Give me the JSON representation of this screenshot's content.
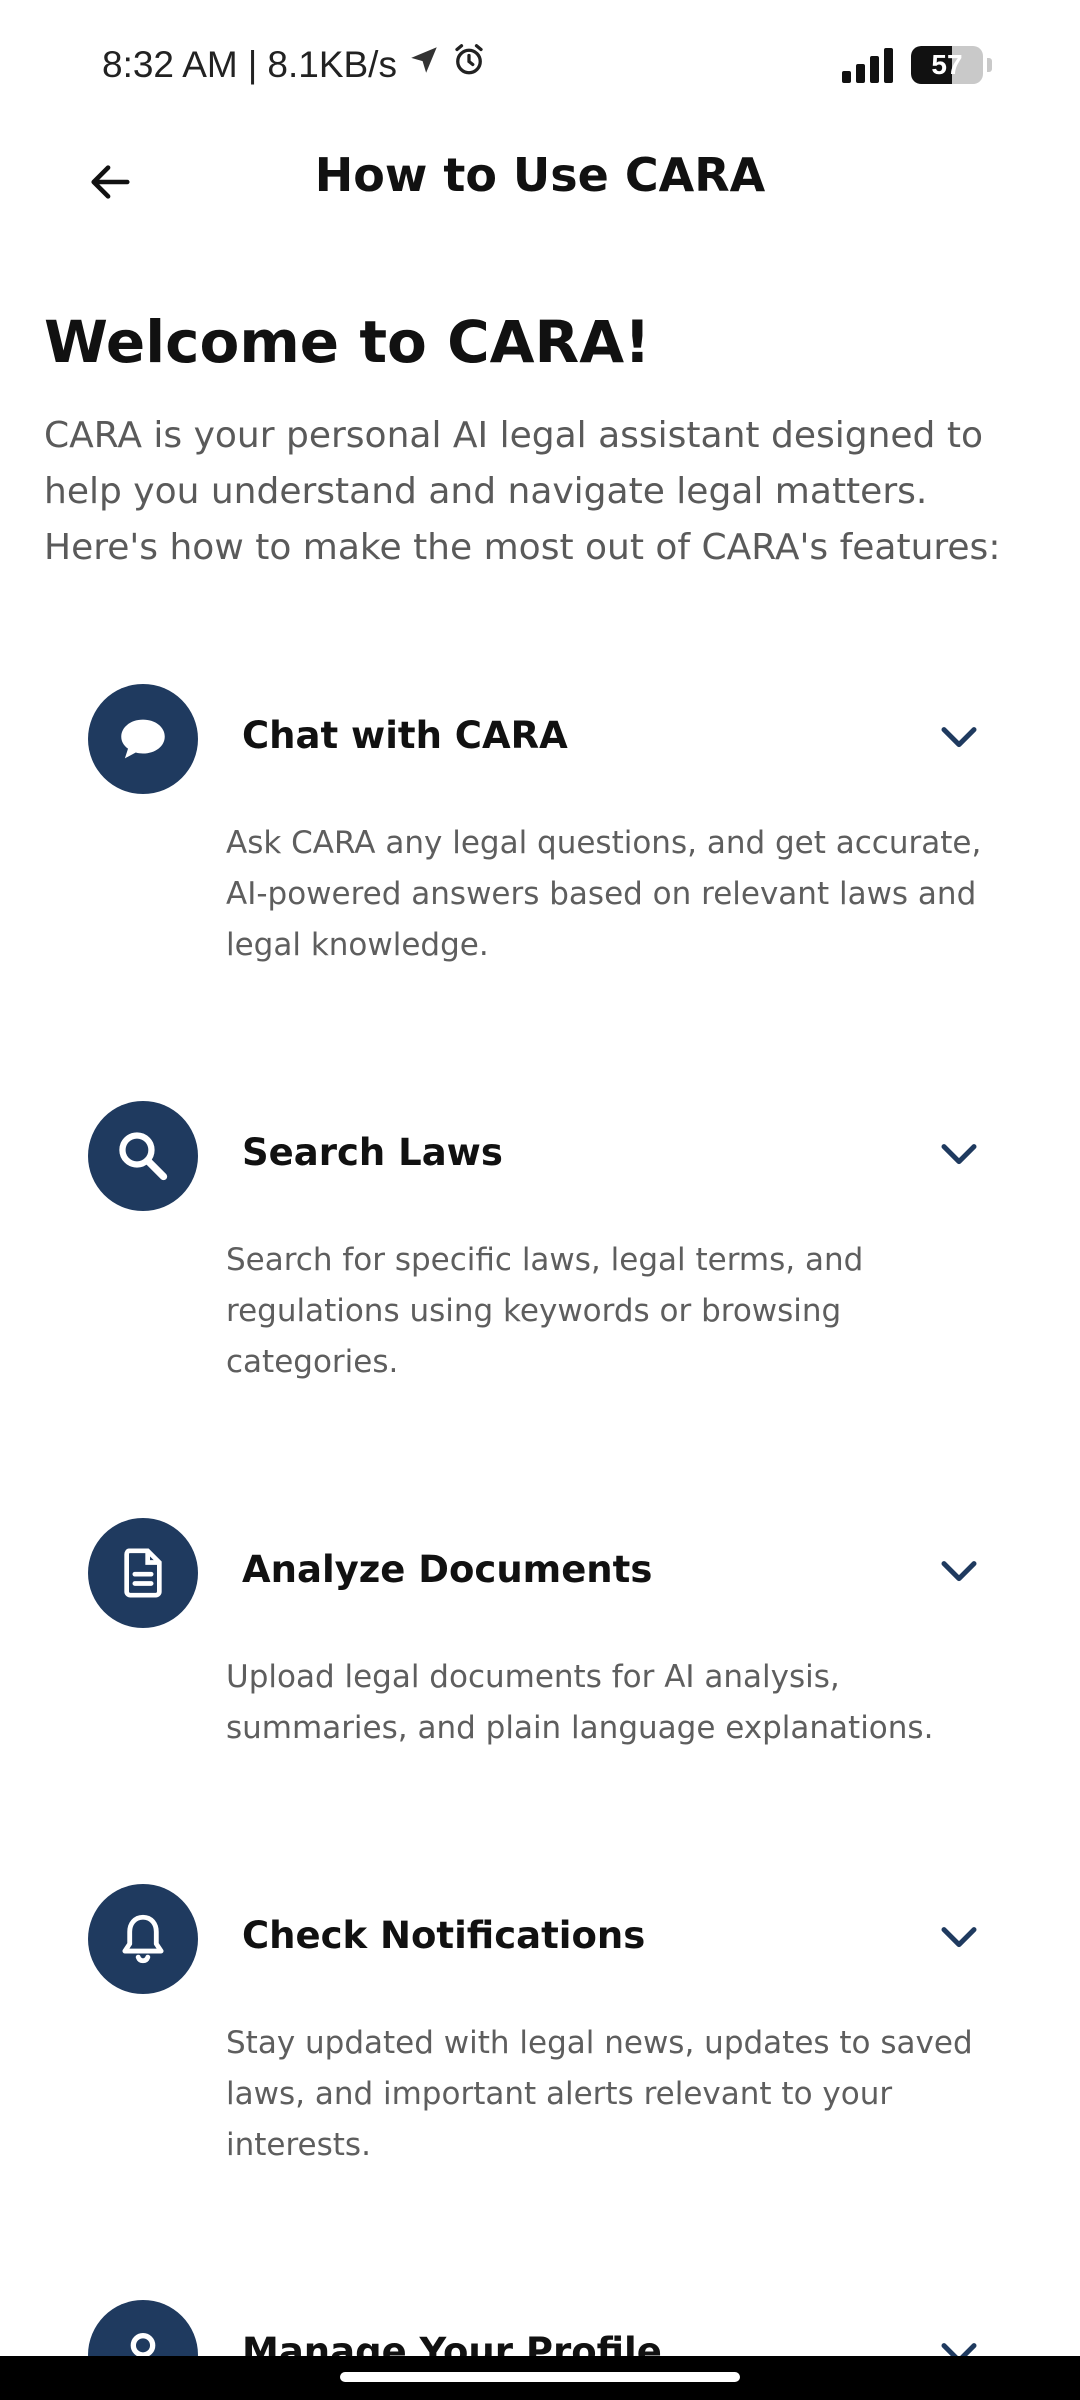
{
  "status_bar": {
    "time": "8:32 AM",
    "separator": "|",
    "network_speed": "8.1KB/s",
    "battery_level": "57",
    "battery_fraction": 0.57,
    "icons": [
      "location-arrow-icon",
      "alarm-icon",
      "signal-icon",
      "battery-icon"
    ]
  },
  "header": {
    "back_icon": "arrow-left-icon",
    "title": "How to Use CARA"
  },
  "intro": {
    "title": "Welcome to CARA!",
    "description": "CARA is your personal AI legal assistant designed to help you understand and navigate legal matters. Here's how to make the most out of CARA's features:"
  },
  "features": [
    {
      "icon": "chat-bubble-icon",
      "title": "Chat with CARA",
      "description": "Ask CARA any legal questions, and get accurate, AI-powered answers based on relevant laws and legal knowledge."
    },
    {
      "icon": "search-icon",
      "title": "Search Laws",
      "description": "Search for specific laws, legal terms, and regulations using keywords or browsing categories."
    },
    {
      "icon": "document-icon",
      "title": "Analyze Documents",
      "description": "Upload legal documents for AI analysis, summaries, and plain language explanations."
    },
    {
      "icon": "bell-icon",
      "title": "Check Notifications",
      "description": "Stay updated with legal news, updates to saved laws, and important alerts relevant to your interests."
    },
    {
      "icon": "user-icon",
      "title": "Manage Your Profile",
      "description": ""
    }
  ],
  "colors": {
    "accent": "#1f3a5f",
    "text_primary": "#111111",
    "text_secondary": "#5e5e5e"
  }
}
